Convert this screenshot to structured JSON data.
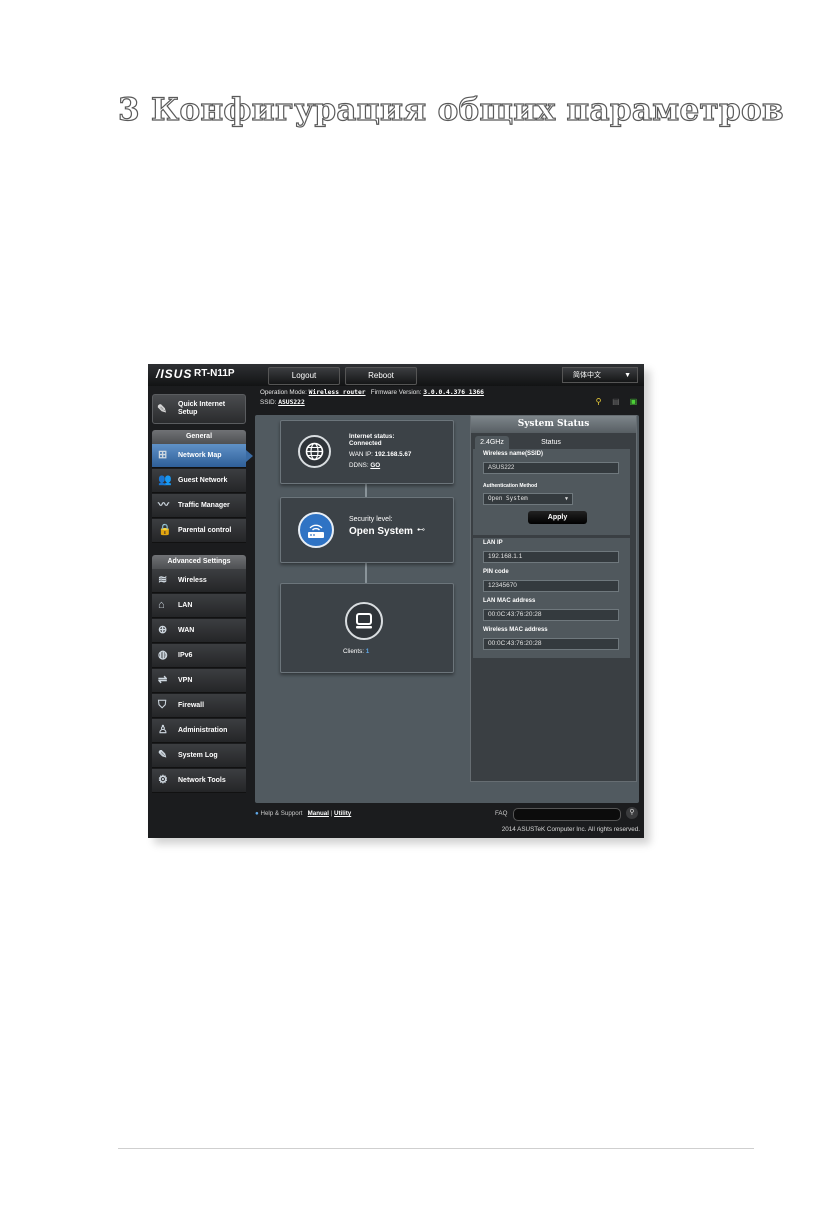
{
  "doc": {
    "title": "3 Конфигурация общих параметров"
  },
  "topbar": {
    "logo": "/ISUS",
    "model": "RT-N11P",
    "logout": "Logout",
    "reboot": "Reboot",
    "language": "简体中文",
    "language_arrow": "▼"
  },
  "info": {
    "op_mode_label": "Operation Mode:",
    "op_mode_value": "Wireless router",
    "fw_label": "Firmware Version:",
    "fw_value": "3.0.0.4.376_1366",
    "ssid_label": "SSID:",
    "ssid_value": "ASUS222"
  },
  "sidebar": {
    "qis_label_1": "Quick Internet",
    "qis_label_2": "Setup",
    "general_header": "General",
    "general_items": [
      {
        "label": "Network Map"
      },
      {
        "label": "Guest Network"
      },
      {
        "label": "Traffic Manager"
      },
      {
        "label": "Parental control"
      }
    ],
    "advanced_header": "Advanced Settings",
    "advanced_items": [
      {
        "label": "Wireless"
      },
      {
        "label": "LAN"
      },
      {
        "label": "WAN"
      },
      {
        "label": "IPv6"
      },
      {
        "label": "VPN"
      },
      {
        "label": "Firewall"
      },
      {
        "label": "Administration"
      },
      {
        "label": "System Log"
      },
      {
        "label": "Network Tools"
      }
    ]
  },
  "map": {
    "internet_status_label": "Internet status:",
    "internet_status_value": "Connected",
    "wan_ip_label": "WAN IP:",
    "wan_ip_value": "192.168.5.67",
    "ddns_label": "DDNS:",
    "ddns_value": "GO",
    "security_label": "Security level:",
    "security_value": "Open System",
    "clients_label": "Clients:",
    "clients_value": "1"
  },
  "system_status": {
    "title": "System Status",
    "tab_24": "2.4GHz",
    "tab_status": "Status",
    "wireless_name_label": "Wireless name(SSID)",
    "wireless_name_value": "ASUS222",
    "auth_label": "Authentication Method",
    "auth_value": "Open System",
    "apply": "Apply",
    "lan_ip_label": "LAN IP",
    "lan_ip_value": "192.168.1.1",
    "pin_label": "PIN code",
    "pin_value": "12345670",
    "lan_mac_label": "LAN MAC address",
    "lan_mac_value": "00:0C:43:76:20:28",
    "wireless_mac_label": "Wireless MAC address",
    "wireless_mac_value": "00:0C:43:76:20:28"
  },
  "footer": {
    "help": "Help & Support",
    "manual": "Manual",
    "sep": "|",
    "utility": "Utility",
    "faq": "FAQ",
    "copyright": "2014 ASUSTeK Computer Inc. All rights reserved."
  }
}
